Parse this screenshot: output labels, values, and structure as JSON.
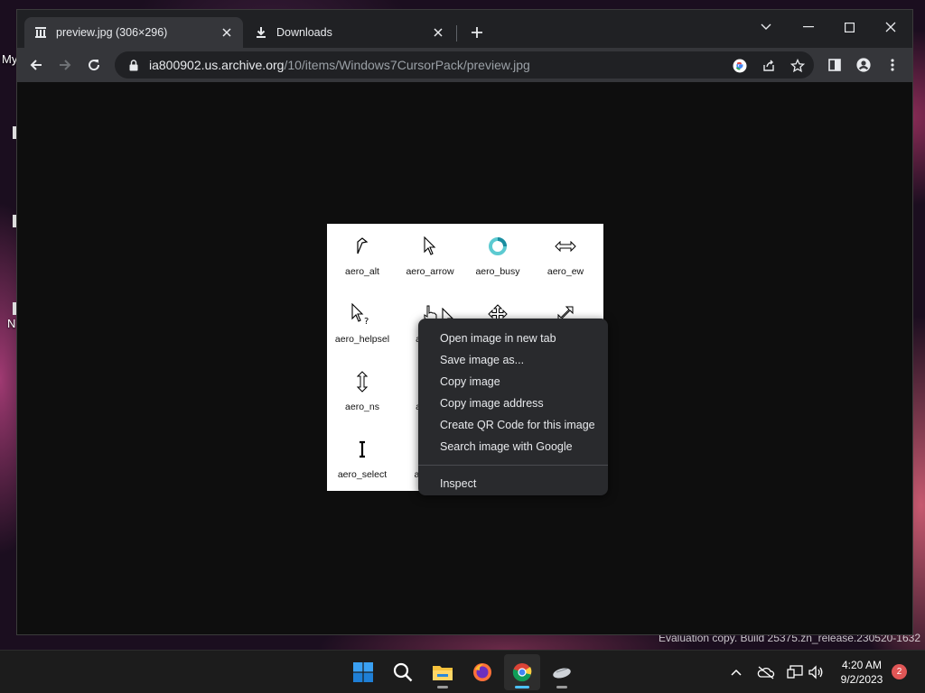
{
  "desktop": {
    "label_1": "My",
    "label_2": "N",
    "watermark": "Evaluation copy. Build 25375.zn_release.230520-1632"
  },
  "browser": {
    "tabs": [
      {
        "title": "preview.jpg (306×296)",
        "active": true,
        "icon": "archive-icon"
      },
      {
        "title": "Downloads",
        "active": false,
        "icon": "download-icon"
      }
    ],
    "address": {
      "domain": "ia800902.us.archive.org",
      "path": "/10/items/Windows7CursorPack/preview.jpg"
    }
  },
  "preview_image": {
    "cursors": [
      {
        "label": "aero_alt",
        "icon": "alt-cursor"
      },
      {
        "label": "aero_arrow",
        "icon": "arrow-cursor"
      },
      {
        "label": "aero_busy",
        "icon": "busy-cursor"
      },
      {
        "label": "aero_ew",
        "icon": "ew-cursor"
      },
      {
        "label": "aero_helpsel",
        "icon": "helpsel-cursor"
      },
      {
        "label": "ae",
        "icon": "link-cursor"
      },
      {
        "label": "",
        "icon": "move-cursor"
      },
      {
        "label": "",
        "icon": "nesw-cursor"
      },
      {
        "label": "aero_ns",
        "icon": "ns-cursor"
      },
      {
        "label": "ae",
        "icon": ""
      },
      {
        "label": "aero_select",
        "icon": "select-cursor"
      },
      {
        "label": "aero",
        "icon": "unavail-cursor"
      }
    ]
  },
  "context_menu": {
    "items": [
      "Open image in new tab",
      "Save image as...",
      "Copy image",
      "Copy image address",
      "Create QR Code for this image",
      "Search image with Google"
    ],
    "inspect": "Inspect"
  },
  "taskbar": {
    "time": "4:20 AM",
    "date": "9/2/2023",
    "notifications": "2"
  },
  "colors": {
    "accent": "#4cc2ff",
    "tab_active": "#35363a",
    "menu_bg": "#292a2d"
  }
}
